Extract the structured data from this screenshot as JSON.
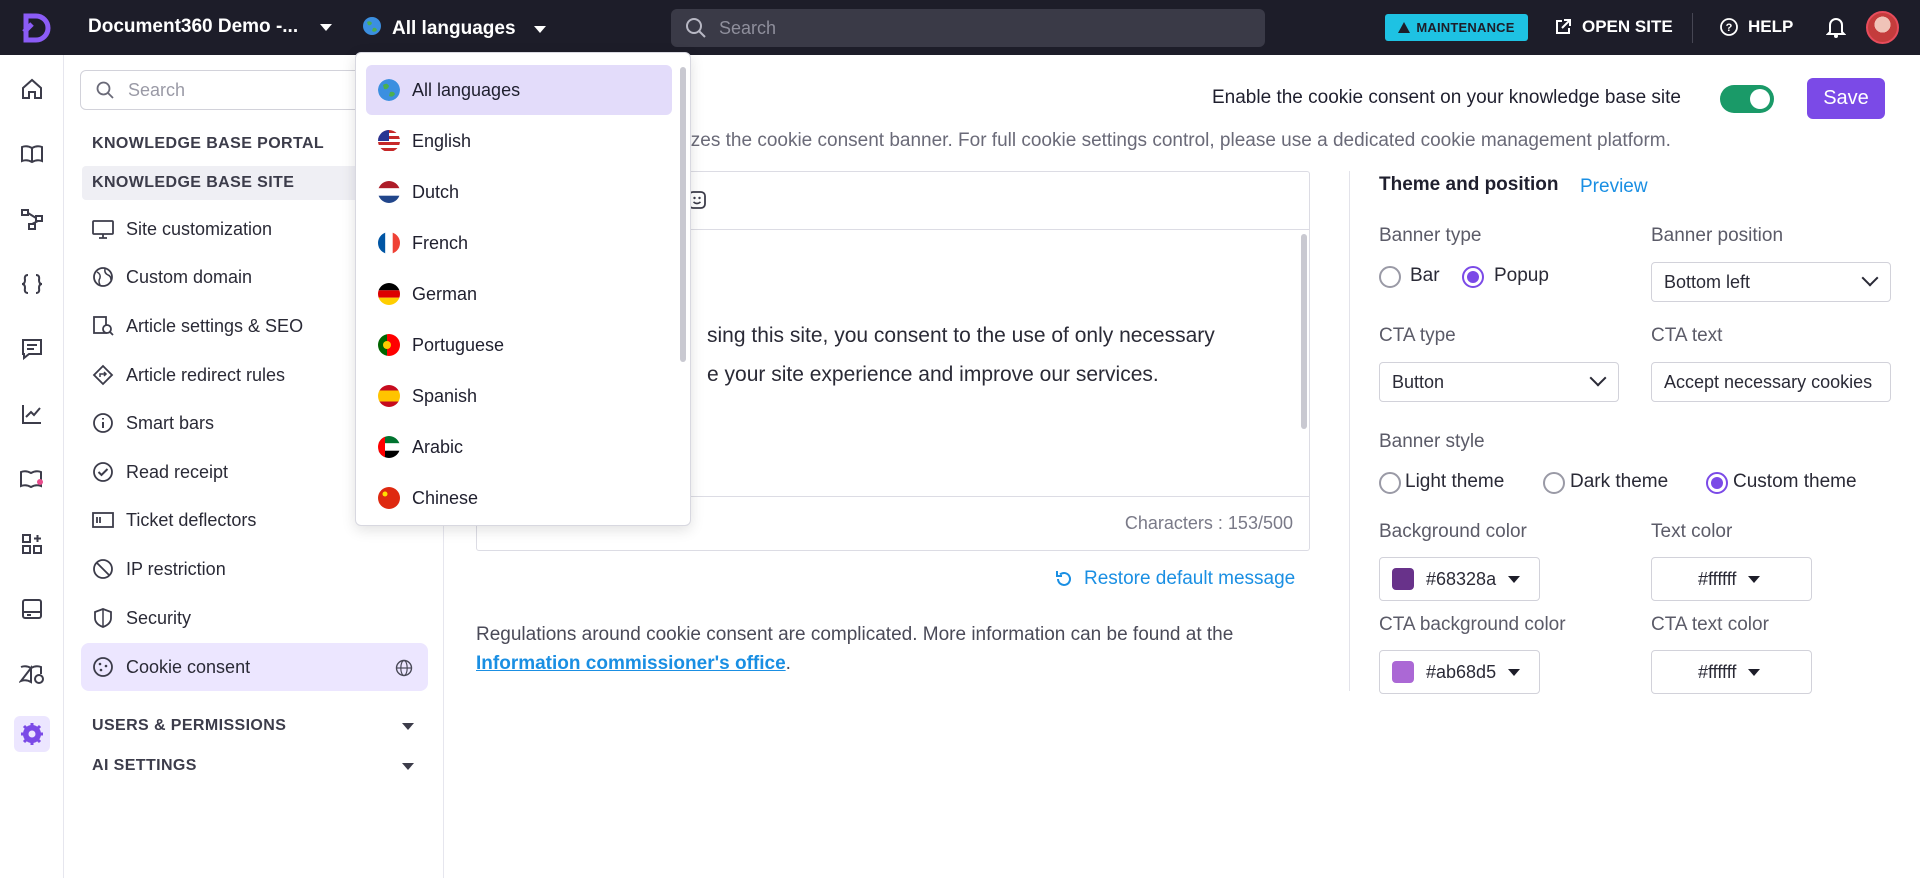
{
  "topbar": {
    "project_name": "Document360 Demo -...",
    "language": "All languages",
    "search_placeholder": "Search",
    "maintenance": "MAINTENANCE",
    "open_site": "OPEN SITE",
    "help": "HELP"
  },
  "sidebar": {
    "search_placeholder": "Search",
    "section_portal": "KNOWLEDGE BASE PORTAL",
    "section_site": "KNOWLEDGE BASE SITE",
    "items": [
      {
        "label": "Site customization",
        "icon": "monitor-icon"
      },
      {
        "label": "Custom domain",
        "icon": "globe-domain-icon"
      },
      {
        "label": "Article settings & SEO",
        "icon": "article-seo-icon"
      },
      {
        "label": "Article redirect rules",
        "icon": "redirect-icon"
      },
      {
        "label": "Smart bars",
        "icon": "info-icon"
      },
      {
        "label": "Read receipt",
        "icon": "check-circle-icon"
      },
      {
        "label": "Ticket deflectors",
        "icon": "ticket-icon"
      },
      {
        "label": "IP restriction",
        "icon": "block-icon"
      },
      {
        "label": "Security",
        "icon": "shield-icon"
      },
      {
        "label": "Cookie consent",
        "icon": "cookie-icon"
      }
    ],
    "section_users": "USERS & PERMISSIONS",
    "section_ai": "AI SETTINGS"
  },
  "main": {
    "enable_label": "Enable the cookie consent on your knowledge base site",
    "enable_on": true,
    "save_label": "Save",
    "description_visible": "nizes the cookie consent banner. For full cookie settings control, please use a dedicated cookie management platform.",
    "editor_text_line1": "sing this site, you consent to the use of only necessary",
    "editor_text_line2": "e your site experience and improve our services.",
    "characters": "Characters : 153/500",
    "restore_label": "Restore default message",
    "regulations_text": "Regulations around cookie consent are complicated. More information can be found at the",
    "regulations_link": "Information commissioner's office",
    "regulations_end": "."
  },
  "settings": {
    "tab_theme": "Theme and position",
    "tab_preview": "Preview",
    "banner_type_label": "Banner type",
    "banner_type_options": [
      "Bar",
      "Popup"
    ],
    "banner_type_selected": "Popup",
    "banner_position_label": "Banner position",
    "banner_position_value": "Bottom left",
    "cta_type_label": "CTA type",
    "cta_type_value": "Button",
    "cta_text_label": "CTA text",
    "cta_text_value": "Accept necessary cookies",
    "banner_style_label": "Banner style",
    "banner_style_options": [
      "Light theme",
      "Dark theme",
      "Custom theme"
    ],
    "banner_style_selected": "Custom theme",
    "bg_color_label": "Background color",
    "bg_color_value": "#68328a",
    "text_color_label": "Text color",
    "text_color_value": "#ffffff",
    "cta_bg_label": "CTA background color",
    "cta_bg_value": "#ab68d5",
    "cta_text_color_label": "CTA text color",
    "cta_text_color_value": "#ffffff"
  },
  "language_dropdown": {
    "items": [
      "All languages",
      "English",
      "Dutch",
      "French",
      "German",
      "Portuguese",
      "Spanish",
      "Arabic",
      "Chinese"
    ],
    "selected": "All languages"
  },
  "colors": {
    "accent": "#7b4ae7",
    "topbar_bg": "#1d1d29",
    "toggle_on": "#1a9a68",
    "link": "#1a8fe3",
    "maintenance": "#1ec2e3"
  }
}
